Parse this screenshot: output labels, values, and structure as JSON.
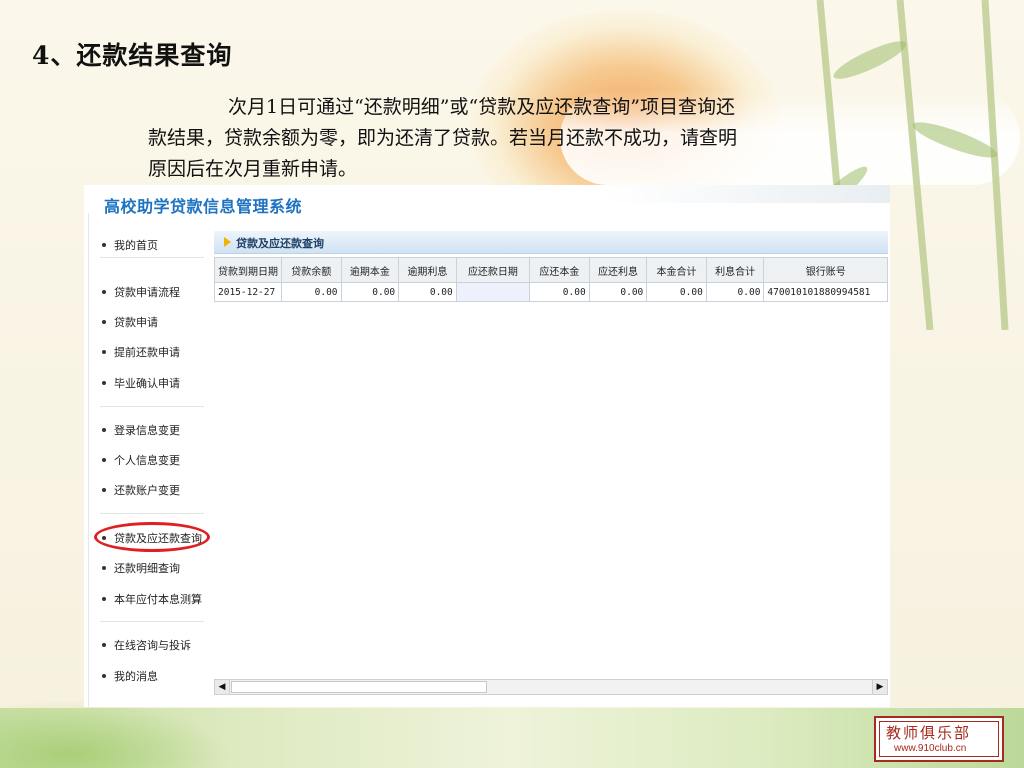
{
  "slide": {
    "title": "4、还款结果查询",
    "paragraph_lines": [
      "次月1日可通过“还款明细”或“贷款及应还款查询”项目查询还",
      "款结果，贷款余额为零，即为还清了贷款。若当月还款不成功，请查明",
      "原因后在次月重新申请。"
    ]
  },
  "app": {
    "title": "高校助学贷款信息管理系统"
  },
  "sidebar": {
    "items": [
      {
        "label": "我的首页"
      },
      {
        "label": "贷款申请流程"
      },
      {
        "label": "贷款申请"
      },
      {
        "label": "提前还款申请"
      },
      {
        "label": "毕业确认申请"
      },
      {
        "label": "登录信息变更"
      },
      {
        "label": "个人信息变更"
      },
      {
        "label": "还款账户变更"
      },
      {
        "label": "贷款及应还款查询",
        "highlighted": true
      },
      {
        "label": "还款明细查询"
      },
      {
        "label": "本年应付本息测算"
      },
      {
        "label": "在线咨询与投诉"
      },
      {
        "label": "我的消息"
      }
    ]
  },
  "panel": {
    "header": "贷款及应还款查询",
    "columns": [
      "贷款到期日期",
      "贷款余额",
      "逾期本金",
      "逾期利息",
      "应还款日期",
      "应还本金",
      "应还利息",
      "本金合计",
      "利息合计",
      "银行账号"
    ],
    "rows": [
      [
        "2015-12-27",
        "0.00",
        "0.00",
        "0.00",
        "",
        "0.00",
        "0.00",
        "0.00",
        "0.00",
        "4700101018809945​81"
      ]
    ]
  },
  "colors": {
    "app_title": "#1d73c2",
    "highlight_ring": "#e02020",
    "panel_header_bg": "#cfe2f3"
  },
  "logo": {
    "line1": "教师俱乐部",
    "line2": "www.910club.cn"
  }
}
